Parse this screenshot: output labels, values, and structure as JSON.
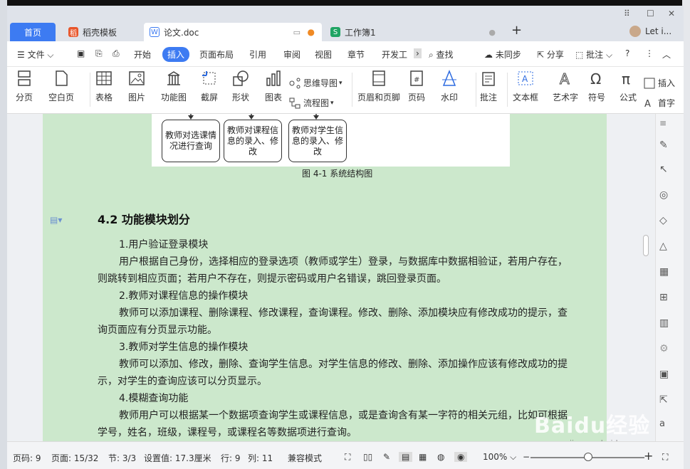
{
  "tabs": {
    "home": "首页",
    "template": "稻壳模板",
    "doc": "论文.doc",
    "sheet": "工作簿1",
    "user": "Let i..."
  },
  "menu": {
    "file": "文件",
    "items": [
      "开始",
      "插入",
      "页面布局",
      "引用",
      "审阅",
      "视图",
      "章节",
      "开发工"
    ],
    "search": "查找",
    "sync": "未同步",
    "share": "分享",
    "comment": "批注"
  },
  "ribbon": {
    "page_break": "分页",
    "blank_page": "空白页",
    "table": "表格",
    "picture": "图片",
    "function_chart": "功能图",
    "screenshot": "截屏",
    "shape": "形状",
    "chart": "图表",
    "mindmap": "思维导图",
    "flowchart": "流程图",
    "header_footer": "页眉和页脚",
    "page_num": "页码",
    "watermark": "水印",
    "annotation": "批注",
    "textbox": "文本框",
    "art_text": "艺术字",
    "symbol": "符号",
    "formula": "公式",
    "insert": "插入",
    "first_letter": "首字"
  },
  "document": {
    "boxes": [
      "教师对选课情况进行查询",
      "教师对课程信息的录入、修改",
      "教师对学生信息的录入、修改"
    ],
    "caption": "图 4-1  系统结构图",
    "heading": "4.2  功能模块划分",
    "paragraphs": [
      "1.用户验证登录模块",
      "用户根据自己身份，选择相应的登录选项（教师或学生）登录，与数据库中数据相验证，若用户存在，则跳转到相应页面；若用户不存在，则提示密码或用户名错误，跳回登录页面。",
      "2.教师对课程信息的操作模块",
      "教师可以添加课程、删除课程、修改课程，查询课程。修改、删除、添加模块应有修改成功的提示，查询页面应有分页显示功能。",
      "3.教师对学生信息的操作模块",
      "教师可以添加、修改，删除、查询学生信息。对学生信息的修改、删除、添加操作应该有修改成功的提示，对学生的查询应该可以分页显示。",
      "4.模糊查询功能",
      "教师用户可以根据某一个数据项查询学生或课程信息，或是查询含有某一字符的相关元组，比如可根据学号，姓名，班级，课程号，或课程名等数据项进行查询。"
    ]
  },
  "status": {
    "page_no": "页码: 9",
    "pages": "页面: 15/32",
    "section": "节: 3/3",
    "setting": "设置值: 17.3厘米",
    "row": "行: 9",
    "col": "列: 11",
    "mode": "兼容模式",
    "zoom": "100%"
  },
  "watermark": {
    "text": "Baidu经验",
    "url": "jingyan.baidu.com"
  },
  "colors": {
    "accent": "#3d7bf2",
    "page_bg": "#cce8cc"
  }
}
